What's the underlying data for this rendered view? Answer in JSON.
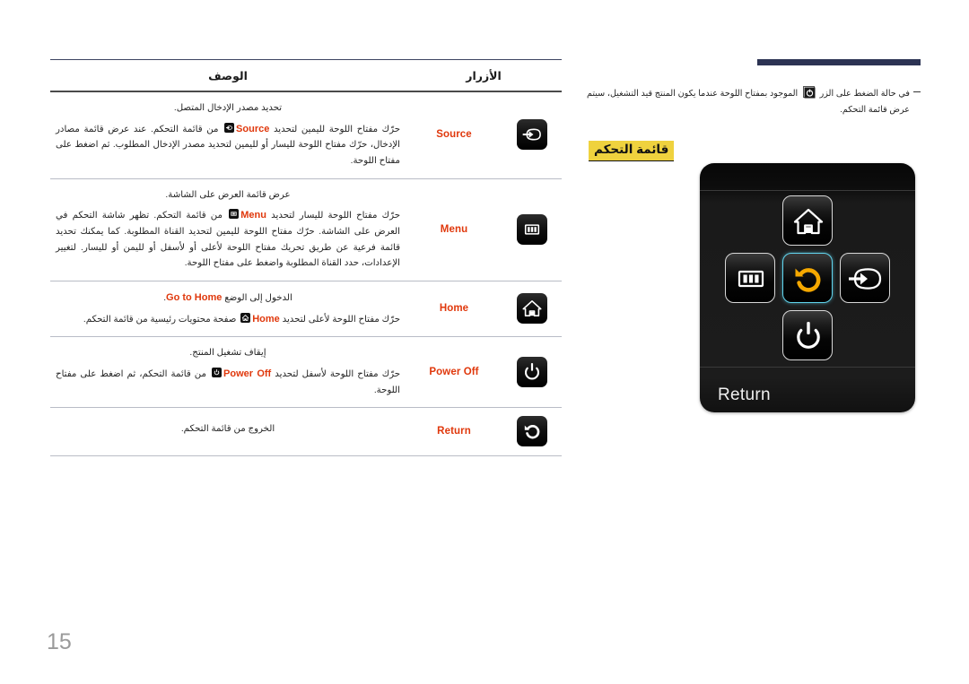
{
  "page": {
    "number": "15",
    "accent_navy": "#2c3353",
    "accent_red": "#e0380c",
    "highlight_yellow": "#efd23e",
    "focus_cyan": "#62d6ef",
    "focus_amber": "#f5a800"
  },
  "table": {
    "header_buttons": "الأزرار",
    "header_description": "الوصف",
    "rows": [
      {
        "icon": "source-icon",
        "label": "Source",
        "lead": "تحديد مصدر الإدخال المتصل.",
        "body_prefix": "حرّك مفتاح اللوحة لليمين لتحديد ",
        "keyword": "Source",
        "body_suffix": " من قائمة التحكم. عند عرض قائمة مصادر الإدخال، حرّك مفتاح اللوحة لليسار أو لليمين لتحديد مصدر الإدخال المطلوب. ثم اضغط على مفتاح اللوحة."
      },
      {
        "icon": "menu-icon",
        "label": "Menu",
        "lead": "عرض قائمة العرض على الشاشة.",
        "body_prefix": "حرّك مفتاح اللوحة لليسار لتحديد ",
        "keyword": "Menu",
        "body_suffix": " من قائمة التحكم. تظهر شاشة التحكم في العرض على الشاشة. حرّك مفتاح اللوحة لليمين لتحديد القناة المطلوبة. كما يمكنك تحديد قائمة فرعية عن طريق تحريك مفتاح اللوحة لأعلى أو لأسفل أو لليمن أو لليسار. لتغيير الإعدادات، حدد القناة المطلوبة واضغط على مفتاح اللوحة."
      },
      {
        "icon": "home-icon",
        "label": "Home",
        "lead_prefix": "الدخول إلى الوضع ",
        "lead_keyword": "Go to Home",
        "lead_suffix": ".",
        "body_prefix": "حرّك مفتاح اللوحة لأعلى لتحديد ",
        "keyword": "Home",
        "body_suffix": " صفحة محتويات رئيسية من قائمة التحكم."
      },
      {
        "icon": "power-icon",
        "label": "Power Off",
        "lead": "إيقاف تشغيل المنتج.",
        "body_prefix": "حرّك مفتاح اللوحة لأسفل لتحديد ",
        "keyword": "Power Off",
        "body_suffix": " من قائمة التحكم، ثم اضغط على مفتاح اللوحة."
      },
      {
        "icon": "return-icon",
        "label": "Return",
        "lead": "الخروج من قائمة التحكم.",
        "body_prefix": "",
        "keyword": "",
        "body_suffix": ""
      }
    ]
  },
  "right": {
    "note_prefix": "في حالة الضغط على الزر ",
    "note_key_icon": "power-boxed-icon",
    "note_suffix": " الموجود بمفتاح اللوحة عندما يكون المنتج قيد التشغيل، سيتم عرض قائمة التحكم.",
    "section_title": "قائمة التحكم"
  },
  "panel": {
    "label": "Return",
    "buttons": [
      {
        "name": "home-button",
        "icon": "home-icon",
        "position": "top",
        "focused": false
      },
      {
        "name": "menu-button",
        "icon": "menu-icon",
        "position": "left",
        "focused": false
      },
      {
        "name": "return-button",
        "icon": "return-icon",
        "position": "center",
        "focused": true
      },
      {
        "name": "source-button",
        "icon": "source-icon",
        "position": "right",
        "focused": false
      },
      {
        "name": "power-button",
        "icon": "power-icon",
        "position": "bottom",
        "focused": false
      }
    ]
  }
}
